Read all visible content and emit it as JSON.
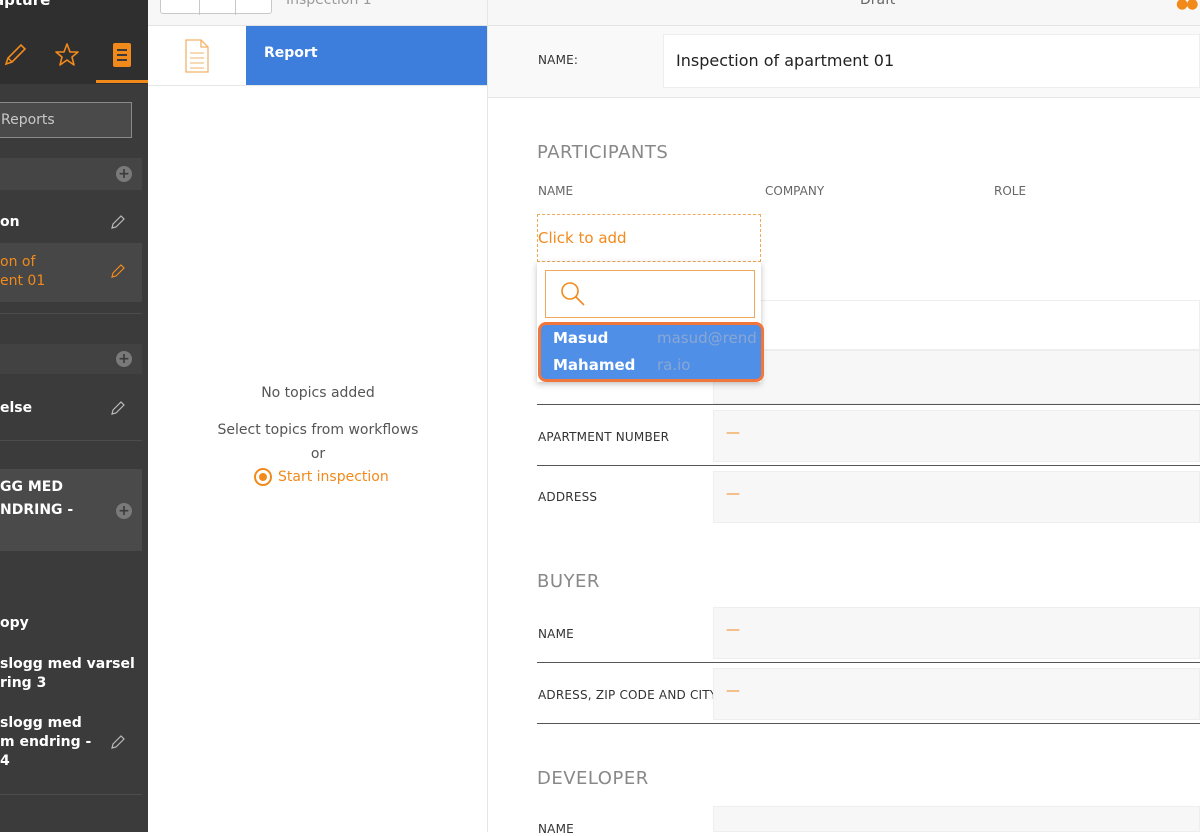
{
  "sidebar": {
    "title": "apture",
    "search_placeholder": "Reports",
    "items": [
      {
        "label": "on"
      },
      {
        "label": "on of",
        "label2": "ent 01"
      },
      {
        "label": "else"
      },
      {
        "label": "GG MED",
        "label2": "NDRING -"
      },
      {
        "label": "opy"
      },
      {
        "label": "slogg med varsel",
        "label2": "ring 3"
      },
      {
        "label": "slogg med",
        "label2": "m endring -",
        "label3": "4"
      }
    ]
  },
  "middle": {
    "title": "Inspection 1",
    "report_tab": "Report",
    "empty_title": "No topics added",
    "empty_sub": "Select topics from workflows",
    "empty_or": "or",
    "start_label": "Start inspection"
  },
  "form": {
    "status": "Draft",
    "name_label": "NAME:",
    "name_value": "Inspection of apartment 01",
    "participants_heading": "PARTICIPANTS",
    "col_name": "NAME",
    "col_company": "COMPANY",
    "col_role": "ROLE",
    "click_to_add": "Click to add",
    "apartment_label": "APARTMENT NUMBER",
    "address_label": "ADDRESS",
    "buyer_heading": "BUYER",
    "buyer_name_label": "NAME",
    "buyer_address_label": "ADRESS, ZIP CODE AND CITY",
    "developer_heading": "DEVELOPER",
    "developer_name_label": "NAME",
    "empty_value": "—"
  },
  "dropdown": {
    "search_placeholder": "",
    "options": [
      {
        "name": "Masud",
        "email": "masud@rend"
      },
      {
        "name": "Mahamed",
        "email": "ra.io"
      }
    ]
  },
  "colors": {
    "accent": "#f28a1b",
    "selection": "#3d7ddc",
    "highlight_border": "#f0763c"
  }
}
